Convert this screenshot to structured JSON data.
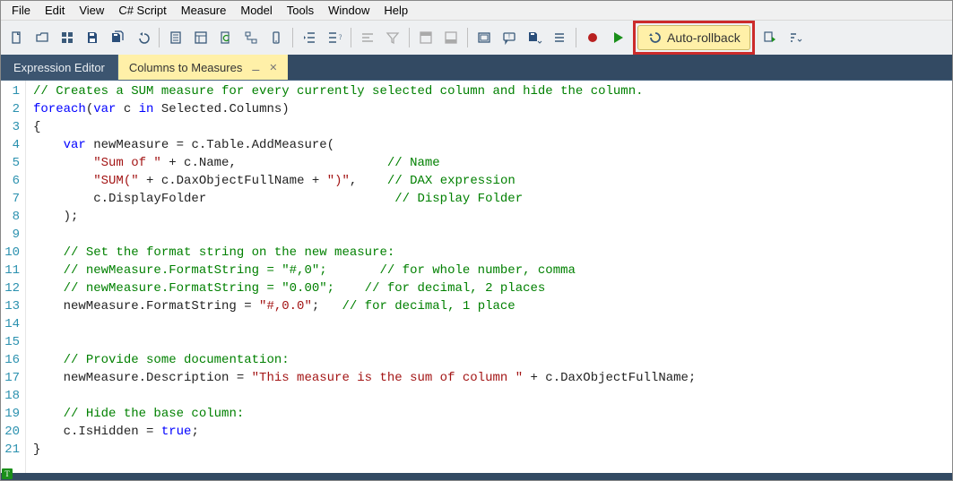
{
  "menubar": {
    "items": [
      "File",
      "Edit",
      "View",
      "C# Script",
      "Measure",
      "Model",
      "Tools",
      "Window",
      "Help"
    ]
  },
  "toolbar": {
    "icons": [
      "new-file",
      "open-folder",
      "tiles",
      "save",
      "save-all",
      "undo",
      "sep",
      "page",
      "layout",
      "refresh-doc",
      "diagram",
      "phone",
      "sep",
      "outdent",
      "indent-question",
      "sep",
      "align",
      "filter",
      "sep",
      "header",
      "footer",
      "sep",
      "frame",
      "comment",
      "save-dropdown",
      "bars",
      "sep",
      "record",
      "play",
      "auto-rollback-slot",
      "script-next",
      "sort-dropdown"
    ],
    "auto_rollback_label": "Auto-rollback"
  },
  "tabs": {
    "panel_label": "Expression Editor",
    "active_tab": "Columns to Measures"
  },
  "code": {
    "lines": [
      [
        {
          "t": "comment",
          "v": "// Creates a SUM measure for every currently selected column and hide the column."
        }
      ],
      [
        {
          "t": "keyword",
          "v": "foreach"
        },
        {
          "t": "plain",
          "v": "("
        },
        {
          "t": "keyword",
          "v": "var"
        },
        {
          "t": "plain",
          "v": " c "
        },
        {
          "t": "keyword",
          "v": "in"
        },
        {
          "t": "plain",
          "v": " Selected.Columns)"
        }
      ],
      [
        {
          "t": "plain",
          "v": "{"
        }
      ],
      [
        {
          "t": "plain",
          "v": "    "
        },
        {
          "t": "keyword",
          "v": "var"
        },
        {
          "t": "plain",
          "v": " newMeasure = c.Table.AddMeasure("
        }
      ],
      [
        {
          "t": "plain",
          "v": "        "
        },
        {
          "t": "string",
          "v": "\"Sum of \""
        },
        {
          "t": "plain",
          "v": " + c.Name,                    "
        },
        {
          "t": "comment",
          "v": "// Name"
        }
      ],
      [
        {
          "t": "plain",
          "v": "        "
        },
        {
          "t": "string",
          "v": "\"SUM(\""
        },
        {
          "t": "plain",
          "v": " + c.DaxObjectFullName + "
        },
        {
          "t": "string",
          "v": "\")\""
        },
        {
          "t": "plain",
          "v": ",    "
        },
        {
          "t": "comment",
          "v": "// DAX expression"
        }
      ],
      [
        {
          "t": "plain",
          "v": "        c.DisplayFolder                         "
        },
        {
          "t": "comment",
          "v": "// Display Folder"
        }
      ],
      [
        {
          "t": "plain",
          "v": "    );"
        }
      ],
      [
        {
          "t": "plain",
          "v": ""
        }
      ],
      [
        {
          "t": "plain",
          "v": "    "
        },
        {
          "t": "comment",
          "v": "// Set the format string on the new measure:"
        }
      ],
      [
        {
          "t": "plain",
          "v": "    "
        },
        {
          "t": "comment",
          "v": "// newMeasure.FormatString = \"#,0\";       // for whole number, comma"
        }
      ],
      [
        {
          "t": "plain",
          "v": "    "
        },
        {
          "t": "comment",
          "v": "// newMeasure.FormatString = \"0.00\";    // for decimal, 2 places"
        }
      ],
      [
        {
          "t": "plain",
          "v": "    newMeasure.FormatString = "
        },
        {
          "t": "string",
          "v": "\"#,0.0\""
        },
        {
          "t": "plain",
          "v": ";   "
        },
        {
          "t": "comment",
          "v": "// for decimal, 1 place"
        }
      ],
      [
        {
          "t": "plain",
          "v": ""
        }
      ],
      [
        {
          "t": "plain",
          "v": ""
        }
      ],
      [
        {
          "t": "plain",
          "v": "    "
        },
        {
          "t": "comment",
          "v": "// Provide some documentation:"
        }
      ],
      [
        {
          "t": "plain",
          "v": "    newMeasure.Description = "
        },
        {
          "t": "string",
          "v": "\"This measure is the sum of column \""
        },
        {
          "t": "plain",
          "v": " + c.DaxObjectFullName;"
        }
      ],
      [
        {
          "t": "plain",
          "v": ""
        }
      ],
      [
        {
          "t": "plain",
          "v": "    "
        },
        {
          "t": "comment",
          "v": "// Hide the base column:"
        }
      ],
      [
        {
          "t": "plain",
          "v": "    c.IsHidden = "
        },
        {
          "t": "keyword",
          "v": "true"
        },
        {
          "t": "plain",
          "v": ";"
        }
      ],
      [
        {
          "t": "plain",
          "v": "}"
        }
      ]
    ]
  }
}
